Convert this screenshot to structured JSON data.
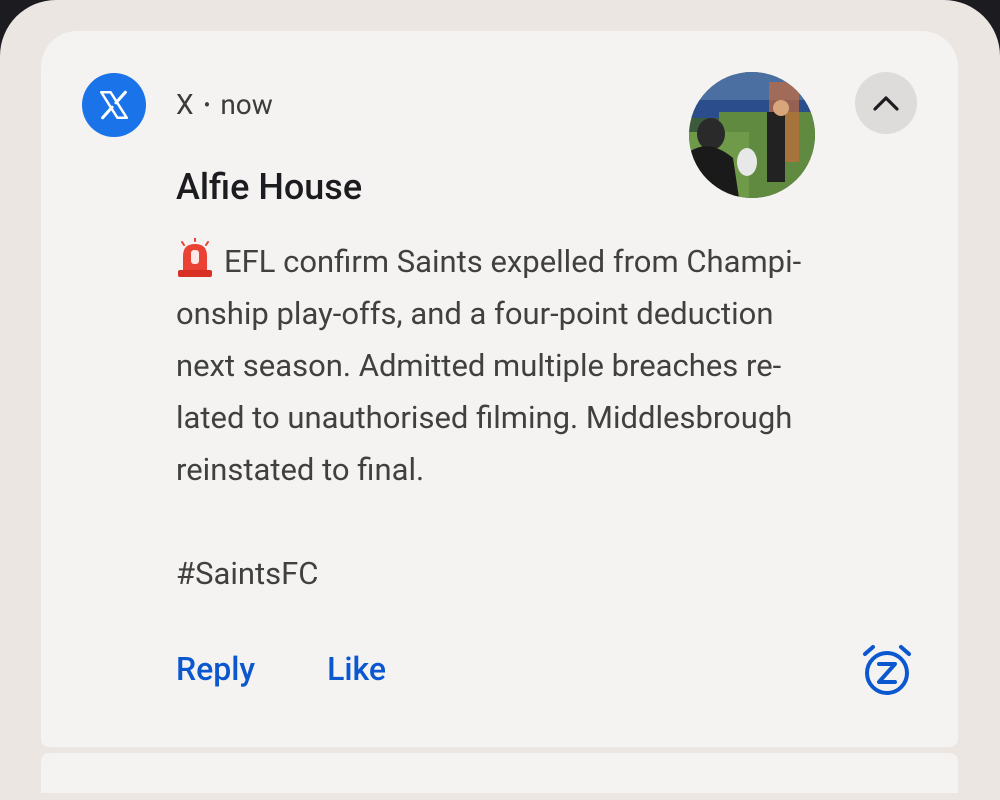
{
  "notification": {
    "app_name": "X",
    "separator": "•",
    "time": "now",
    "title": "Alfie House",
    "body_lines": [
      "EFL confirm Saints expelled from Champi-",
      "onship play-offs, and a four-point deduction",
      "next season. Admitted multiple breaches re-",
      "lated to unauthorised filming. Middlesbrough",
      "reinstated to final.",
      "",
      "#SaintsFC"
    ],
    "icons": {
      "app": "x-logo-icon",
      "leading_emoji": "siren-icon",
      "collapse": "chevron-up-icon",
      "snooze": "snooze-alarm-icon"
    },
    "actions": {
      "reply_label": "Reply",
      "like_label": "Like"
    },
    "colors": {
      "app_icon_bg": "#1a73e8",
      "action_text": "#0b57d0",
      "card_bg": "#f4f3f1",
      "shade_bg": "#ebe6e1"
    }
  }
}
